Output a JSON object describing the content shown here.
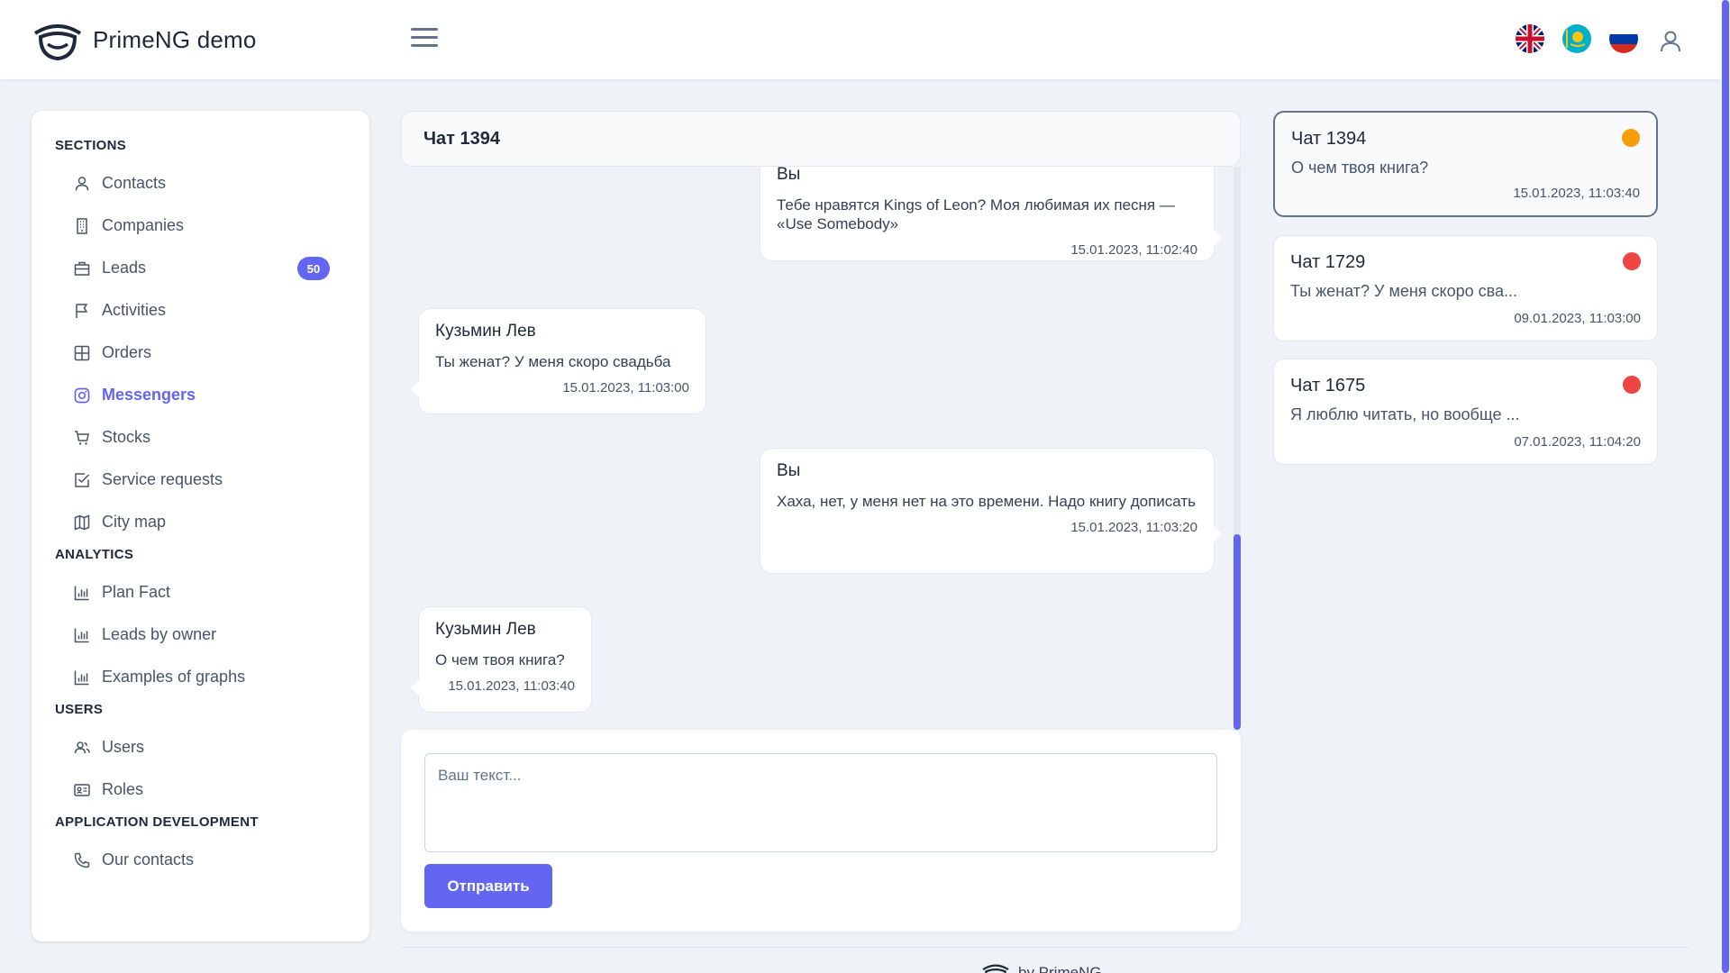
{
  "app": {
    "title": "PrimeNG demo"
  },
  "topbar": {
    "flags": [
      "flag-uk-icon",
      "flag-kazakhstan-icon",
      "flag-russia-icon"
    ]
  },
  "sidebar": {
    "sections": [
      {
        "title": "SECTIONS",
        "items": [
          {
            "label": "Contacts",
            "icon": "user-icon"
          },
          {
            "label": "Companies",
            "icon": "building-icon"
          },
          {
            "label": "Leads",
            "icon": "briefcase-icon",
            "badge": "50"
          },
          {
            "label": "Activities",
            "icon": "flag-icon"
          },
          {
            "label": "Orders",
            "icon": "table-icon"
          },
          {
            "label": "Messengers",
            "icon": "instagram-icon",
            "active": true
          },
          {
            "label": "Stocks",
            "icon": "cart-icon"
          },
          {
            "label": "Service requests",
            "icon": "check-square-icon"
          },
          {
            "label": "City map",
            "icon": "map-icon"
          }
        ]
      },
      {
        "title": "ANALYTICS",
        "items": [
          {
            "label": "Plan Fact",
            "icon": "chart-bar-icon"
          },
          {
            "label": "Leads by owner",
            "icon": "chart-bar-icon"
          },
          {
            "label": "Examples of graphs",
            "icon": "chart-bar-icon"
          }
        ]
      },
      {
        "title": "USERS",
        "items": [
          {
            "label": "Users",
            "icon": "users-icon"
          },
          {
            "label": "Roles",
            "icon": "id-card-icon"
          }
        ]
      },
      {
        "title": "APPLICATION DEVELOPMENT",
        "items": [
          {
            "label": "Our contacts",
            "icon": "phone-icon"
          }
        ]
      }
    ]
  },
  "chat": {
    "title": "Чат 1394",
    "messages": [
      {
        "sender": "Вы",
        "text": "Тебе нравятся Kings of Leon? Моя любимая их песня — «Use Somebody»",
        "time": "15.01.2023, 11:02:40",
        "side": "right"
      },
      {
        "sender": "Кузьмин Лев",
        "text": "Ты женат? У меня скоро свадьба",
        "time": "15.01.2023, 11:03:00",
        "side": "left"
      },
      {
        "sender": "Вы",
        "text": "Хаха, нет, у меня нет на это времени. Надо книгу дописать",
        "time": "15.01.2023, 11:03:20",
        "side": "right"
      },
      {
        "sender": "Кузьмин Лев",
        "text": "О чем твоя книга?",
        "time": "15.01.2023, 11:03:40",
        "side": "left"
      }
    ],
    "input_placeholder": "Ваш текст...",
    "send_label": "Отправить"
  },
  "chat_list": [
    {
      "title": "Чат 1394",
      "preview": "О чем твоя книга?",
      "date": "15.01.2023, 11:03:40",
      "status_color": "#f59e0b",
      "selected": true
    },
    {
      "title": "Чат 1729",
      "preview": "Ты женат? У меня скоро сва...",
      "date": "09.01.2023, 11:03:00",
      "status_color": "#ef4444",
      "selected": false
    },
    {
      "title": "Чат 1675",
      "preview": "Я люблю читать, но вообще ...",
      "date": "07.01.2023, 11:04:20",
      "status_color": "#ef4444",
      "selected": false
    }
  ],
  "footer": {
    "text": "by PrimeNG"
  },
  "colors": {
    "accent": "#6366f1",
    "background": "#eff3f8"
  }
}
